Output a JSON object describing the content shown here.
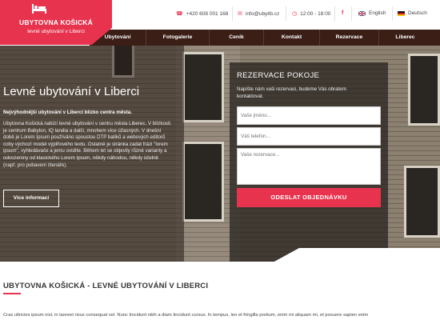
{
  "brand": {
    "title": "UBYTOVNA KOŠICKÁ",
    "subtitle": "levné ubytování v Liberci",
    "icon": "bed-icon",
    "color": "#e8334e"
  },
  "topbar": {
    "phone": "+420 608 001 168",
    "email": "info@ubylib.cz",
    "hours": "12:00 - 18:00",
    "social_icon": "facebook-icon",
    "lang_en": "English",
    "lang_de": "Deutsch"
  },
  "nav": {
    "items": [
      "Ubytování",
      "Fotogalerie",
      "Ceník",
      "Kontakt",
      "Rezervace",
      "Liberec"
    ],
    "color": "#3b1e16"
  },
  "hero": {
    "title": "Levné ubytování v Liberci",
    "subtitle": "Nejvýhodnější ubytování v Liberci blízko centra města.",
    "text": "Ubytovna Košická nabízí levné ubytování v centru města Liberec. V blízkosti je centrum Babylon, IQ landia a další, mnohem více úžasných. V dnešní době je Lorem Ipsum používáno spoustou DTP balíků a webových editorů coby výchozí model výplňového textu. Ostatně je stránka zadat frázi \"lorem ipsum\", vyhledávače a jemu ovidíte. Během let se objevily různé varianty a odvozeniny od klasického Lorem Ipsum, někdy náhodou, někdy účelně (např. pro pobavení čtenáře).",
    "button": "Více informací"
  },
  "form": {
    "title": "REZERVACE POKOJE",
    "description": "Napište nám vaši rezervaci, budeme Vás obratem kontaktovat.",
    "name_placeholder": "Vaše jméno...",
    "phone_placeholder": "Váš telefon...",
    "message_placeholder": "Vaše rezervace...",
    "submit": "ODESLAT OBJEDNÁVKU"
  },
  "content": {
    "title": "UBYTOVNA KOŠICKÁ - LEVNÉ UBYTOVÁNÍ V LIBERCI",
    "text": "Cras ultricies ipsum nisl, in laoreet risus consequat vel. Nunc tincidunt nibh a diam tincidunt cursus. In tempus, leo et fringilla pretium, enim mi aliquam mi, et posuere sapien enim"
  }
}
